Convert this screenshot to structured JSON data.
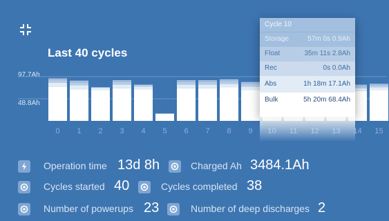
{
  "title": "Last 40 cycles",
  "y_axis": {
    "top_label": "97.7Ah",
    "mid_label": "48.8Ah"
  },
  "x_axis": {
    "labels": [
      "0",
      "1",
      "2",
      "3",
      "4",
      "5",
      "6",
      "7",
      "8",
      "9",
      "10",
      "11",
      "12",
      "13",
      "14",
      "15"
    ]
  },
  "chart_data": {
    "type": "bar",
    "categories": [
      "0",
      "1",
      "2",
      "3",
      "4",
      "5",
      "6",
      "7",
      "8",
      "9",
      "10",
      "11",
      "12",
      "13",
      "14",
      "15"
    ],
    "stacks": [
      "Bulk",
      "Abs",
      "Rec",
      "Float",
      "Storage"
    ],
    "series": [
      {
        "name": "Bulk",
        "values": [
          76,
          70,
          68,
          72,
          70,
          16,
          72,
          72,
          74,
          68,
          68.4,
          68,
          70,
          66,
          66,
          68
        ]
      },
      {
        "name": "Abs",
        "values": [
          8,
          9,
          6,
          8,
          6,
          0,
          8,
          8,
          8,
          8,
          17.1,
          8,
          8,
          8,
          6,
          6
        ]
      },
      {
        "name": "Rec",
        "values": [
          0,
          0,
          0,
          0,
          0,
          0,
          0,
          0,
          0,
          0,
          0.0,
          0,
          0,
          0,
          0,
          0
        ]
      },
      {
        "name": "Float",
        "values": [
          6,
          6,
          0,
          6,
          4,
          0,
          6,
          6,
          6,
          6,
          2.8,
          6,
          6,
          6,
          4,
          4
        ]
      },
      {
        "name": "Storage",
        "values": [
          4,
          4,
          0,
          4,
          0,
          0,
          4,
          4,
          4,
          4,
          0.9,
          4,
          4,
          4,
          4,
          4
        ]
      }
    ],
    "ylim": [
      0,
      97.7
    ],
    "ytick_labels": [
      "97.7Ah",
      "48.8Ah"
    ],
    "colors": {
      "Bulk": "#ffffff",
      "Abs": "#e2ecf7",
      "Rec": "#cbdaec",
      "Float": "#b7cde6",
      "Storage": "#a3bfdf"
    },
    "selected_index": 10
  },
  "tooltip": {
    "title": "Cycle 10",
    "rows": [
      {
        "label": "Storage",
        "value": "57m 0s  0.9Ah"
      },
      {
        "label": "Float",
        "value": "35m 11s  2.8Ah"
      },
      {
        "label": "Rec",
        "value": "0s  0.0Ah"
      },
      {
        "label": "Abs",
        "value": "1h 18m  17.1Ah"
      },
      {
        "label": "Bulk",
        "value": "5h 20m  68.4Ah"
      }
    ]
  },
  "stats": [
    [
      {
        "label": "Operation time",
        "value": "13d 8h",
        "icon": "lightning-icon"
      },
      {
        "label": "Charged Ah",
        "value": "3484.1Ah",
        "icon": "target-icon"
      }
    ],
    [
      {
        "label": "Cycles started",
        "value": "40",
        "icon": "target-icon"
      },
      {
        "label": "Cycles completed",
        "value": "38",
        "icon": "target-icon"
      }
    ],
    [
      {
        "label": "Number of powerups",
        "value": "23",
        "icon": "target-icon"
      },
      {
        "label": "Number of deep discharges",
        "value": "2",
        "icon": "target-icon"
      }
    ]
  ],
  "colors": {
    "background": "#3d75b1",
    "badge": "#7fa6d3",
    "popup_header": "#a3bfdf"
  }
}
